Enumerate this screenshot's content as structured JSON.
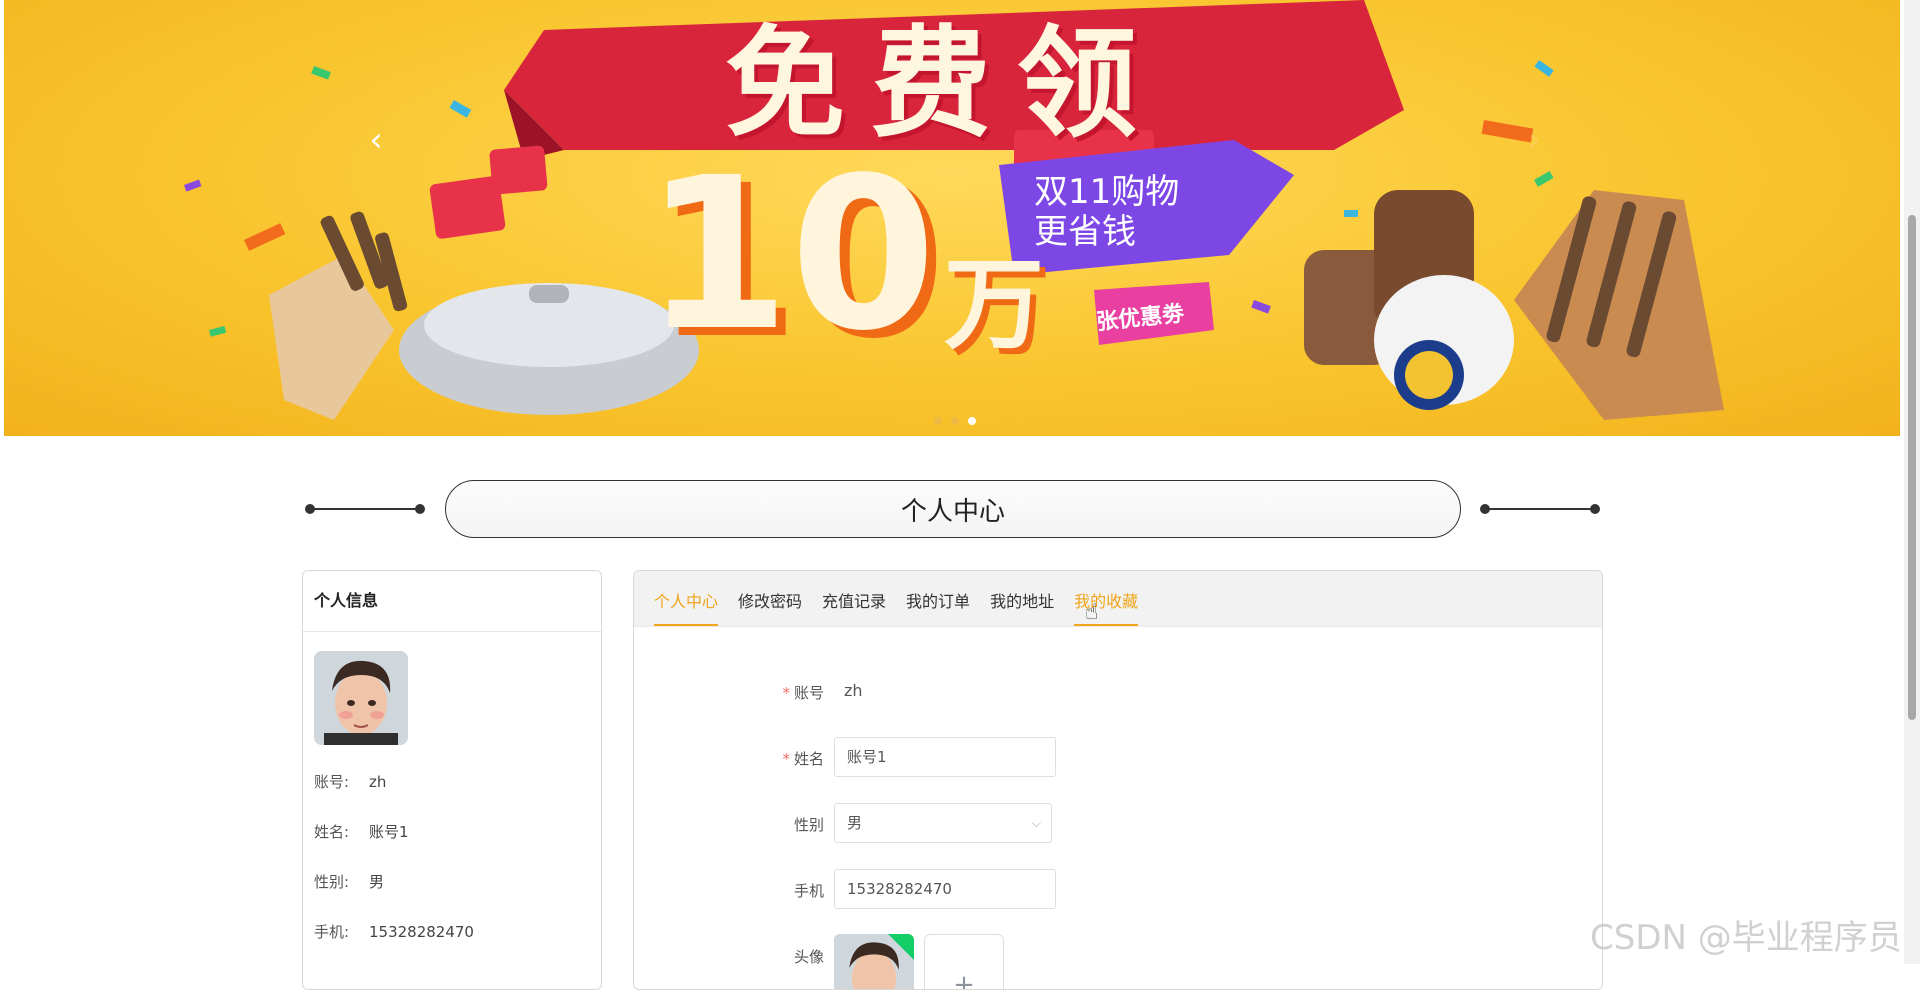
{
  "banner": {
    "title": "免费领",
    "amount": "10",
    "unit": "万",
    "tag_line1": "双11购物",
    "tag_line2": "更省钱",
    "coupon_label": "张优惠劵",
    "prev_arrow": "‹",
    "next_arrow": "›",
    "dots_count": 3,
    "active_dot": 3
  },
  "section": {
    "title": "个人中心"
  },
  "profile_card": {
    "header": "个人信息",
    "rows": [
      {
        "label": "账号:",
        "value": "zh"
      },
      {
        "label": "姓名:",
        "value": "账号1"
      },
      {
        "label": "性别:",
        "value": "男"
      },
      {
        "label": "手机:",
        "value": "15328282470"
      }
    ]
  },
  "tabs": [
    {
      "label": "个人中心",
      "active": true
    },
    {
      "label": "修改密码",
      "active": false
    },
    {
      "label": "充值记录",
      "active": false
    },
    {
      "label": "我的订单",
      "active": false
    },
    {
      "label": "我的地址",
      "active": false
    },
    {
      "label": "我的收藏",
      "active": false,
      "hover": true
    }
  ],
  "form": {
    "account_label": "账号",
    "account_value": "zh",
    "name_label": "姓名",
    "name_value": "账号1",
    "gender_label": "性别",
    "gender_value": "男",
    "phone_label": "手机",
    "phone_value": "15328282470",
    "avatar_label": "头像",
    "upload_add_icon": "+"
  },
  "watermark": "CSDN @毕业程序员",
  "colors": {
    "accent": "#f0a51a",
    "required": "#f56c6c",
    "banner_bg": "#f9c52e",
    "banner_ribbon": "#d9253c",
    "success": "#13ce66"
  }
}
